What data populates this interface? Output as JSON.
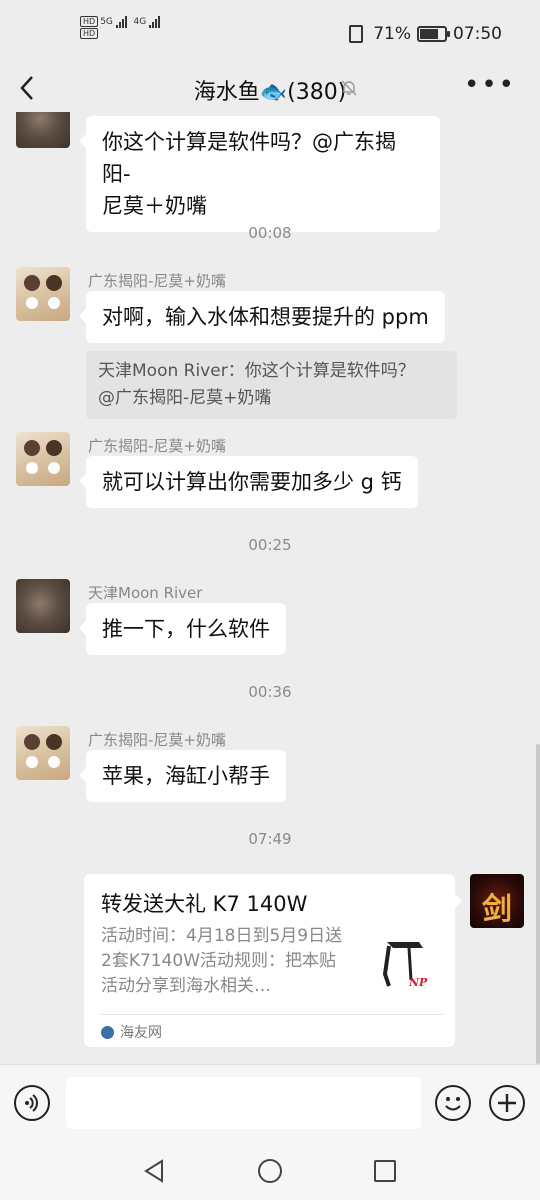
{
  "status": {
    "battery": "71%",
    "time": "07:50",
    "network_a": "5G",
    "network_b": "4G",
    "hd_label": "HD"
  },
  "titlebar": {
    "title": "海水鱼🐟(380)",
    "back_icon": "chevron-left-icon",
    "mute_icon": "bell-off-icon",
    "more_icon": "more-dots-icon"
  },
  "messages": [
    {
      "text": "你这个计算是软件吗？@广东揭阳-\n尼莫＋奶嘴"
    },
    {
      "sender": "广东揭阳-尼莫+奶嘴",
      "text": "对啊，输入水体和想要提升的 ppm",
      "quote": "天津Moon River：你这个计算是软件吗？\n@广东揭阳-尼莫+奶嘴"
    },
    {
      "sender": "广东揭阳-尼莫+奶嘴",
      "text": "就可以计算出你需要加多少 g 钙"
    },
    {
      "sender": "天津Moon River",
      "text": "推一下，什么软件"
    },
    {
      "sender": "广东揭阳-尼莫+奶嘴",
      "text": "苹果，海缸小帮手"
    }
  ],
  "times": [
    "00:08",
    "00:25",
    "00:36",
    "07:49"
  ],
  "card": {
    "title": "转发送大礼 K7 140W",
    "desc": "活动时间：4月18日到5月9日送2套K7140W活动规则：把本贴活动分享到海水相关…",
    "source": "海友网",
    "thumb_text": "NP"
  },
  "avatars": {
    "self_char": "剑"
  },
  "input": {
    "voice_icon": "voice-icon",
    "emoji_icon": "emoji-icon",
    "plus_icon": "plus-icon"
  },
  "nav": {
    "back_icon": "triangle-back-icon",
    "home_icon": "circle-home-icon",
    "recent_icon": "square-recent-icon"
  }
}
